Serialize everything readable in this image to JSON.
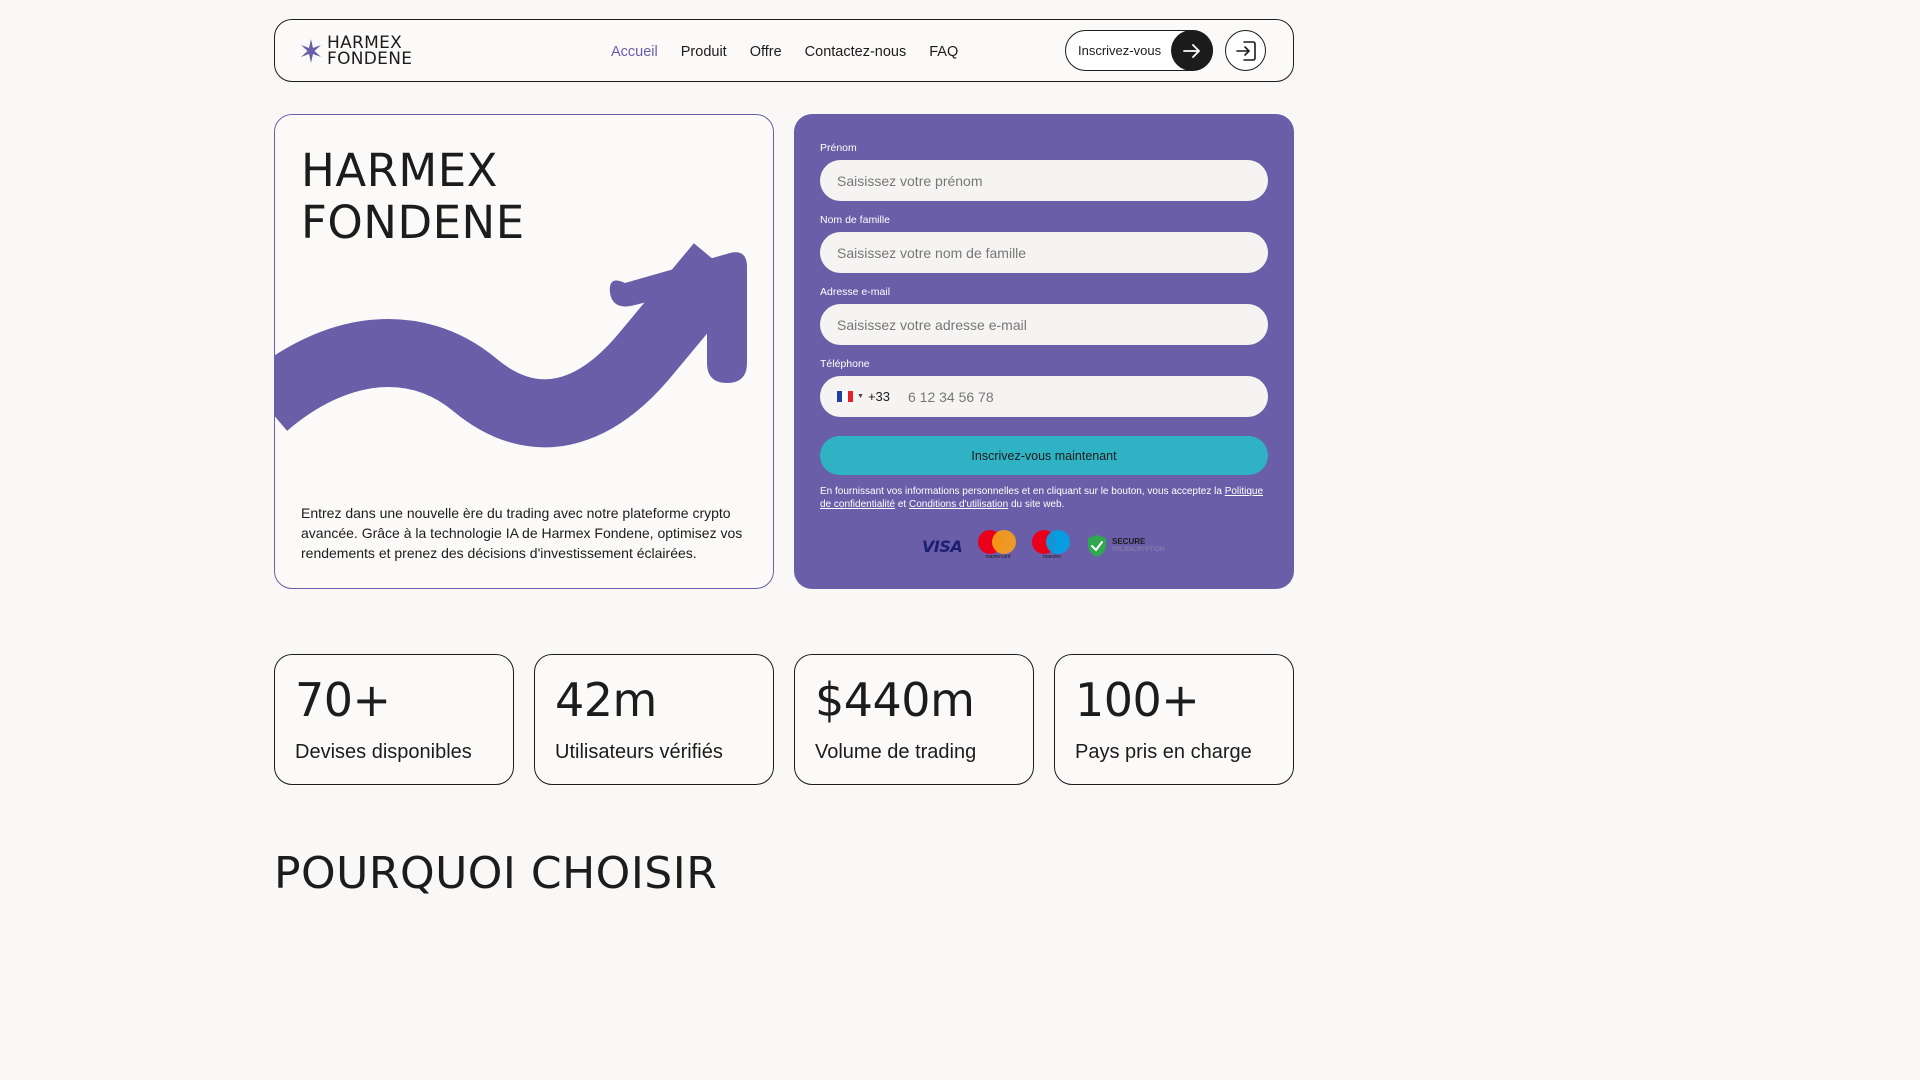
{
  "header": {
    "logo_line1": "HARMEX",
    "logo_line2": "FONDENE",
    "nav": [
      "Accueil",
      "Produit",
      "Offre",
      "Contactez-nous",
      "FAQ"
    ],
    "signup_label": "Inscrivez-vous"
  },
  "hero": {
    "title_line1": "HARMEX",
    "title_line2": "FONDENE",
    "description": "Entrez dans une nouvelle ère du trading avec notre plateforme crypto avancée. Grâce à la technologie IA de Harmex Fondene, optimisez vos rendements et prenez des décisions d'investissement éclairées."
  },
  "form": {
    "first_name_label": "Prénom",
    "first_name_placeholder": "Saisissez votre prénom",
    "last_name_label": "Nom de famille",
    "last_name_placeholder": "Saisissez votre nom de famille",
    "email_label": "Adresse e-mail",
    "email_placeholder": "Saisissez votre adresse e-mail",
    "phone_label": "Téléphone",
    "phone_prefix": "+33",
    "phone_placeholder": "6 12 34 56 78",
    "submit_label": "Inscrivez-vous maintenant",
    "legal_text": "En fournissant vos informations personnelles et en cliquant sur le bouton, vous acceptez la",
    "privacy_link": "Politique de confidentialité",
    "legal_and": "et",
    "terms_link": "Conditions d'utilisation",
    "legal_suffix": "du site web.",
    "payment_visa": "VISA",
    "payment_mastercard": "mastercard",
    "payment_maestro": "maestro",
    "secure_title": "SECURE",
    "secure_sub": "SSL ENCRYPTION"
  },
  "stats": [
    {
      "value": "70+",
      "label": "Devises disponibles"
    },
    {
      "value": "42m",
      "label": "Utilisateurs vérifiés"
    },
    {
      "value": "$440m",
      "label": "Volume de trading"
    },
    {
      "value": "100+",
      "label": "Pays pris en charge"
    }
  ],
  "section": {
    "title": "POURQUOI CHOISIR"
  },
  "colors": {
    "brand": "#6b5ea8",
    "cta": "#2fb3c4",
    "dark": "#1c1c1c"
  }
}
